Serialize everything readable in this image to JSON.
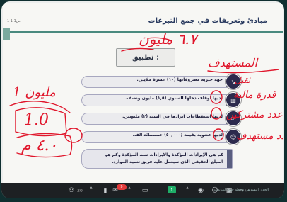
{
  "slide": {
    "title": "مبادئ وتعريفات في جمع التبرعات",
    "title_prefix": "ص1 1 1",
    "practice_label": "تطبيق :",
    "items": [
      {
        "text": "جهة خيرية مصروفاتها (١٠) عشرة ملايين.",
        "icon": "chart-down-icon"
      },
      {
        "text": "لديها اوقاف دخلها السنوي (١,٥) مليون ونصف.",
        "icon": "bar-chart-icon"
      },
      {
        "text": "لديها استقطاعات ايرادها في السنة (٢) مليونين.",
        "icon": "refresh-icon"
      },
      {
        "text": "لديها عضوية بقيمة (٥٠,٠٠٠) خمسمائة الف.",
        "icon": "users-icon"
      }
    ],
    "note_line1": "كم هي الإيرادات المؤكدة والايرادات شبه المؤكدة وكم هو",
    "note_line2": "المبلغ الحقيقي الذي سيعمل عليه فريق تنمية الموارد."
  },
  "annotations": {
    "top_amount": "٦.٧ مليون",
    "right_1": "المستهدف",
    "right_2": "قدرة مالية",
    "right_3": "عدد مشتركين",
    "right_4": "عدد مستهدف",
    "left_1": "1 مليون",
    "left_2": "1.0",
    "left_3": "٤.٠ م",
    "small_1": "ثقيل"
  },
  "toolbar": {
    "participants_count": "20",
    "chat_badge": "9",
    "bottom_caption": "الجدار التسويقي وخطة جمع التبرعات"
  },
  "colors": {
    "ink": "#e0162b",
    "accent": "#4a8a7f",
    "icon_bg": "#2c2a4d",
    "share": "#1fae68"
  }
}
